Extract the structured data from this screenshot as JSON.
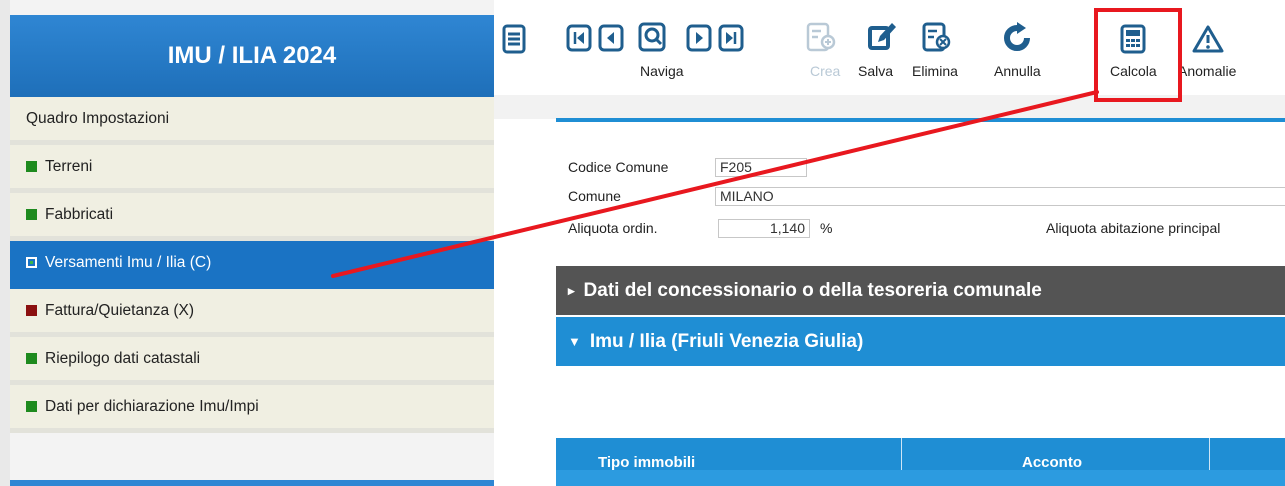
{
  "sidebar": {
    "title": "IMU / ILIA 2024",
    "items": [
      {
        "label": "Quadro Impostazioni",
        "marker": "none",
        "active": false
      },
      {
        "label": "Terreni",
        "marker": "green-square",
        "color": "#1e8a1e",
        "active": false
      },
      {
        "label": "Fabbricati",
        "marker": "green-square",
        "color": "#1e8a1e",
        "active": false
      },
      {
        "label": "Versamenti Imu / Ilia (C)",
        "marker": "hollow-green-square",
        "color": "#39b54a",
        "active": true
      },
      {
        "label": "Fattura/Quietanza (X)",
        "marker": "red-square",
        "color": "#8b1010",
        "active": false
      },
      {
        "label": "Riepilogo dati catastali",
        "marker": "green-square",
        "color": "#1e8a1e",
        "active": false
      },
      {
        "label": "Dati per dichiarazione Imu/Impi",
        "marker": "green-square",
        "color": "#1e8a1e",
        "active": false
      }
    ]
  },
  "toolbar": {
    "menu_icon": "hamburger-icon",
    "naviga_label": "Naviga",
    "nav_icons": [
      "first-record-icon",
      "previous-record-icon",
      "search-record-icon",
      "next-record-icon",
      "last-record-icon"
    ],
    "crea_label": "Crea",
    "salva_label": "Salva",
    "elimina_label": "Elimina",
    "annulla_label": "Annulla",
    "calcola_label": "Calcola",
    "anomalie_label": "Anomalie"
  },
  "form": {
    "codice_comune_label": "Codice Comune",
    "codice_comune_value": "F205",
    "comune_label": "Comune",
    "comune_value": "MILANO",
    "aliquota_ordin_label": "Aliquota ordin.",
    "aliquota_ordin_value": "1,140",
    "percent_label": "%",
    "aliquota_abitazione_label": "Aliquota abitazione principal"
  },
  "sections": {
    "concessionario": "Dati del concessionario o della tesoreria comunale",
    "imu_ilia": "Imu / Ilia (Friuli Venezia Giulia)"
  },
  "table": {
    "headers": [
      "Tipo immobili",
      "Acconto"
    ]
  },
  "colors": {
    "brand_blue": "#1f8ed4",
    "sidebar_active": "#1a73c4",
    "annotation_red": "#e8181f",
    "icon_blue": "#1f5e8e"
  }
}
